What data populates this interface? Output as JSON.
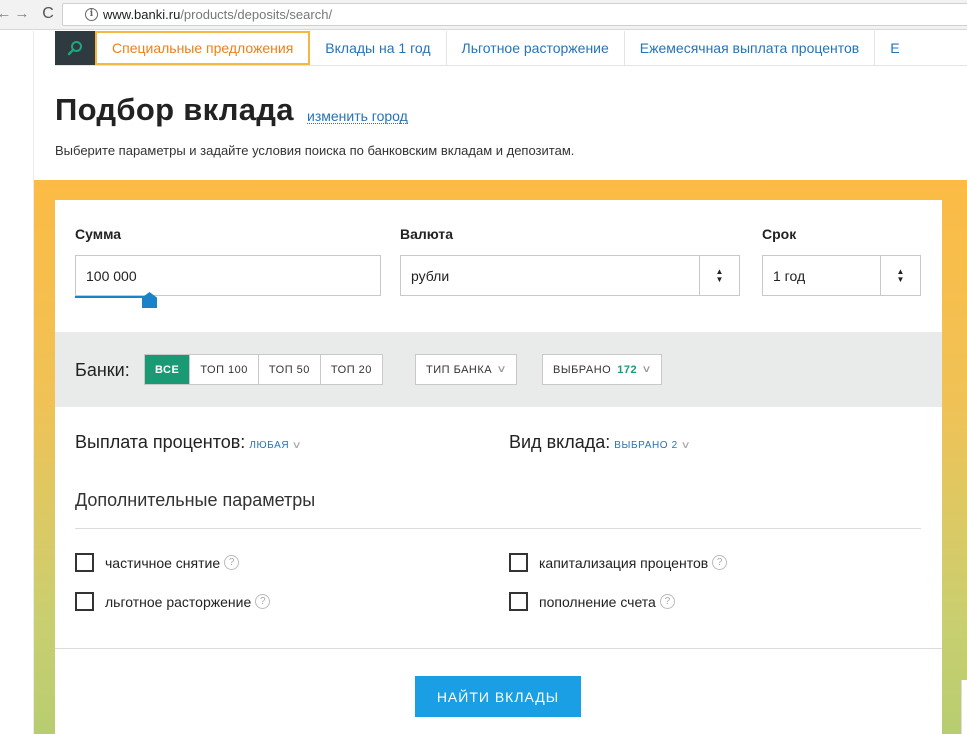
{
  "browser": {
    "url_host": "www.banki.ru",
    "url_path": "/products/deposits/search/",
    "back_glyph": "←",
    "forward_glyph": "→",
    "reload_glyph": "C",
    "info_glyph": "i"
  },
  "tabs": [
    {
      "label": "Специальные предложения",
      "active": true
    },
    {
      "label": "Вклады на 1 год"
    },
    {
      "label": "Льготное расторжение"
    },
    {
      "label": "Ежемесячная выплата процентов"
    },
    {
      "label": "E"
    }
  ],
  "search_icon": "search-icon",
  "page": {
    "title": "Подбор вклада",
    "change_city": "изменить город",
    "subtitle": "Выберите параметры и задайте условия поиска по банковским вкладам и депозитам."
  },
  "form": {
    "amount_label": "Сумма",
    "amount_value": "100 000",
    "currency_label": "Валюта",
    "currency_value": "рубли",
    "term_label": "Срок",
    "term_value": "1 год",
    "select_up": "▲",
    "select_down": "▼"
  },
  "banks": {
    "label": "Банки:",
    "filters": [
      "ВСЕ",
      "ТОП 100",
      "ТОП 50",
      "ТОП 20"
    ],
    "bank_type": "ТИП БАНКА",
    "selected_label": "ВЫБРАНО",
    "selected_count": "172"
  },
  "chevron": "∨",
  "payout": {
    "label": "Выплата процентов:",
    "value": "ЛЮБАЯ"
  },
  "deposit_type": {
    "label": "Вид вклада:",
    "value": "ВЫБРАНО 2"
  },
  "extra": {
    "title": "Дополнительные параметры",
    "help_glyph": "?",
    "options": [
      "частичное снятие",
      "капитализация процентов",
      "льготное расторжение",
      "пополнение счета"
    ]
  },
  "submit": "НАЙТИ ВКЛАДЫ",
  "colors": {
    "accent_green": "#1a9a74",
    "accent_blue": "#1a9ee4",
    "tab_active": "#ef7f1a"
  }
}
